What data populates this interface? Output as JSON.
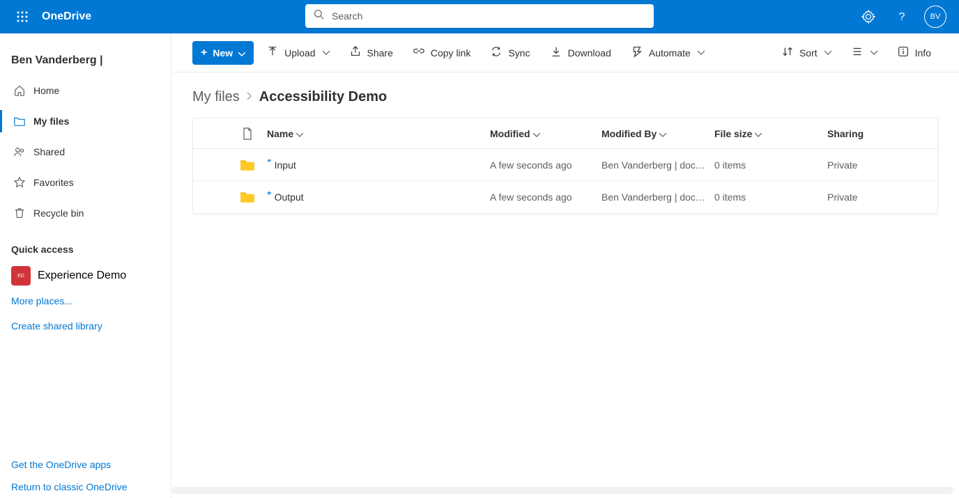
{
  "header": {
    "app_name": "OneDrive",
    "search_placeholder": "Search",
    "avatar_initials": "BV"
  },
  "sidebar": {
    "user_name": "Ben Vanderberg |",
    "items": [
      {
        "label": "Home",
        "icon": "home-icon"
      },
      {
        "label": "My files",
        "icon": "folder-icon",
        "active": true
      },
      {
        "label": "Shared",
        "icon": "people-icon"
      },
      {
        "label": "Favorites",
        "icon": "star-icon"
      },
      {
        "label": "Recycle bin",
        "icon": "trash-icon"
      }
    ],
    "quick_access_title": "Quick access",
    "quick_items": [
      {
        "label": "Experience Demo",
        "badge": "ED",
        "color": "#d13438"
      }
    ],
    "more_places": "More places...",
    "create_library": "Create shared library",
    "bottom_links": [
      "Get the OneDrive apps",
      "Return to classic OneDrive"
    ]
  },
  "toolbar": {
    "new_label": "New",
    "upload_label": "Upload",
    "share_label": "Share",
    "copylink_label": "Copy link",
    "sync_label": "Sync",
    "download_label": "Download",
    "automate_label": "Automate",
    "sort_label": "Sort",
    "info_label": "Info"
  },
  "breadcrumb": {
    "root": "My files",
    "current": "Accessibility Demo"
  },
  "table": {
    "headers": {
      "name": "Name",
      "modified": "Modified",
      "modified_by": "Modified By",
      "file_size": "File size",
      "sharing": "Sharing"
    },
    "rows": [
      {
        "name": "Input",
        "modified": "A few seconds ago",
        "modified_by": "Ben Vanderberg | docume",
        "size": "0 items",
        "sharing": "Private"
      },
      {
        "name": "Output",
        "modified": "A few seconds ago",
        "modified_by": "Ben Vanderberg | docume",
        "size": "0 items",
        "sharing": "Private"
      }
    ]
  }
}
